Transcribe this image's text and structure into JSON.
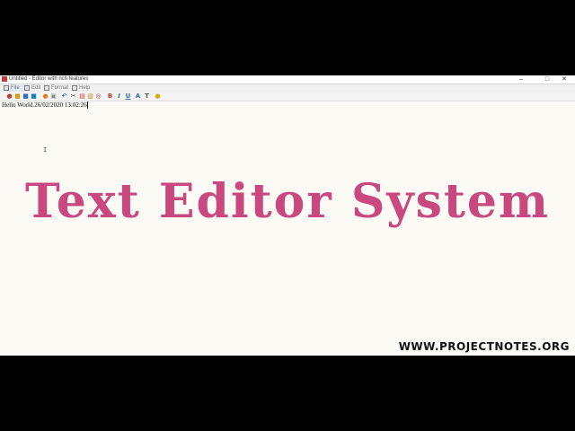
{
  "window": {
    "title": "Untitled - Editor with rich features",
    "minimize": "–",
    "maximize": "□",
    "close": "✕"
  },
  "menu": {
    "file": "File",
    "edit": "Edit",
    "format": "Format",
    "help": "Help"
  },
  "toolbar": {
    "bold": "B",
    "italic": "I",
    "underline": "U",
    "font_color": "A",
    "text_case": "T"
  },
  "editor": {
    "content": "Hello World.26/02/2020 13:02:26"
  },
  "overlay": {
    "title": "Text Editor System",
    "watermark": "WWW.PROJECTNOTES.ORG"
  },
  "colors": {
    "overlay_title": "#c9487f",
    "titlebar": "#ffffff",
    "editor_bg": "#fbfaf5"
  }
}
